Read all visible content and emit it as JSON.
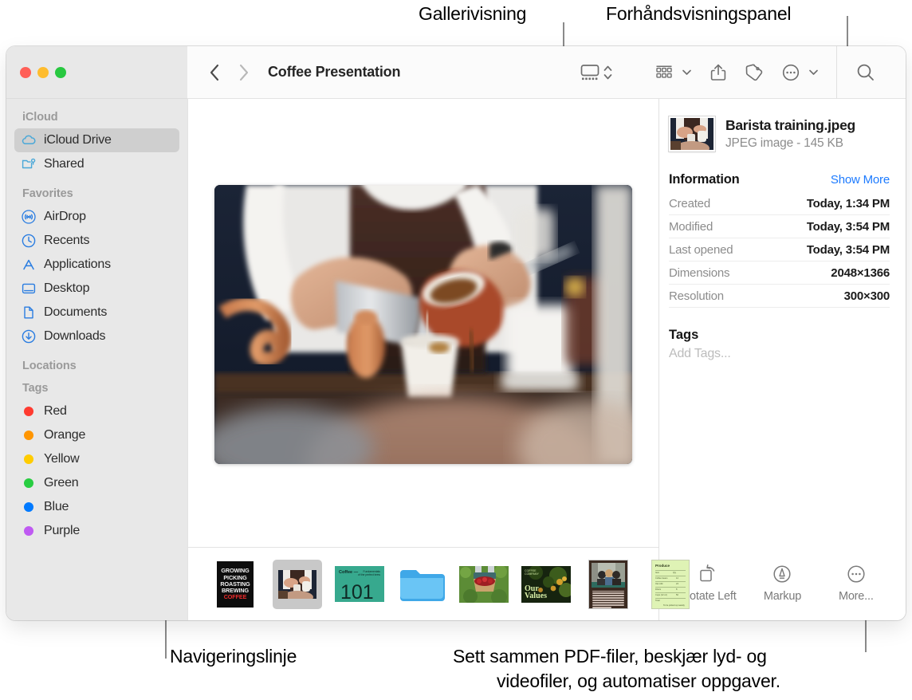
{
  "callouts": {
    "gallery_view": "Gallerivisning",
    "preview_panel": "Forhåndsvisningspanel",
    "navigation_bar": "Navigeringslinje",
    "bottom_note_line1": "Sett sammen PDF-filer, beskjær lyd- og",
    "bottom_note_line2": "videofiler, og automatiser oppgaver."
  },
  "window": {
    "title": "Coffee Presentation",
    "traffic_lights": [
      {
        "name": "close",
        "color": "#ff5f57"
      },
      {
        "name": "minimize",
        "color": "#febc2e"
      },
      {
        "name": "zoom",
        "color": "#28c840"
      }
    ],
    "toolbar": {
      "back_icon": "chevron-left-icon",
      "forward_icon": "chevron-right-icon",
      "view_gallery_icon": "gallery-view-icon",
      "view_stepper_icon": "chevron-up-down-icon",
      "group_icon": "group-by-icon",
      "group_chevron_icon": "chevron-down-icon",
      "share_icon": "share-icon",
      "tag_icon": "tag-icon",
      "more_icon": "more-circle-icon",
      "more_chevron_icon": "chevron-down-icon",
      "search_icon": "search-icon"
    }
  },
  "sidebar": {
    "sections": [
      {
        "header": "iCloud",
        "items": [
          {
            "label": "iCloud Drive",
            "icon": "icloud-icon",
            "selected": true
          },
          {
            "label": "Shared",
            "icon": "shared-folder-icon",
            "selected": false
          }
        ]
      },
      {
        "header": "Favorites",
        "items": [
          {
            "label": "AirDrop",
            "icon": "airdrop-icon",
            "selected": false
          },
          {
            "label": "Recents",
            "icon": "clock-icon",
            "selected": false
          },
          {
            "label": "Applications",
            "icon": "applications-icon",
            "selected": false
          },
          {
            "label": "Desktop",
            "icon": "desktop-icon",
            "selected": false
          },
          {
            "label": "Documents",
            "icon": "document-icon",
            "selected": false
          },
          {
            "label": "Downloads",
            "icon": "downloads-icon",
            "selected": false
          }
        ]
      },
      {
        "header": "Locations",
        "items": []
      },
      {
        "header": "Tags",
        "items": [
          {
            "label": "Red",
            "icon": "tag-dot-icon",
            "color": "#ff3b30",
            "selected": false
          },
          {
            "label": "Orange",
            "icon": "tag-dot-icon",
            "color": "#ff9500",
            "selected": false
          },
          {
            "label": "Yellow",
            "icon": "tag-dot-icon",
            "color": "#ffcc00",
            "selected": false
          },
          {
            "label": "Green",
            "icon": "tag-dot-icon",
            "color": "#28cd41",
            "selected": false
          },
          {
            "label": "Blue",
            "icon": "tag-dot-icon",
            "color": "#007aff",
            "selected": false
          },
          {
            "label": "Purple",
            "icon": "tag-dot-icon",
            "color": "#bf5af2",
            "selected": false
          }
        ]
      }
    ]
  },
  "gallery": {
    "hero_alt": "Barista pouring coffee from a carafe into a paper cup",
    "thumbnails": [
      {
        "name": "coffee-poster-thumb",
        "kind": "poster",
        "selected": false
      },
      {
        "name": "barista-photo-thumb",
        "kind": "photo",
        "selected": true
      },
      {
        "name": "coffee-101-thumb",
        "kind": "slide101",
        "selected": false
      },
      {
        "name": "folder-thumb",
        "kind": "folder",
        "selected": false
      },
      {
        "name": "berries-photo-thumb",
        "kind": "berries",
        "selected": false
      },
      {
        "name": "our-values-thumb",
        "kind": "values",
        "selected": false
      },
      {
        "name": "meeting-document-thumb",
        "kind": "doc",
        "selected": false
      },
      {
        "name": "produce-form-thumb",
        "kind": "form",
        "selected": false
      }
    ],
    "poster_lines": [
      "GROWING",
      "PICKING",
      "ROASTING",
      "BREWING"
    ],
    "poster_accent_line": "COFFEE",
    "slide101_number": "101",
    "slide101_label": "Coffee —",
    "values_title_line1": "Our",
    "values_title_line2": "Values",
    "form_title": "Produce"
  },
  "info_panel": {
    "file_name": "Barista training.jpeg",
    "file_meta": "JPEG image - 145 KB",
    "information_title": "Information",
    "show_more": "Show More",
    "rows": [
      {
        "key": "Created",
        "value": "Today, 1:34 PM"
      },
      {
        "key": "Modified",
        "value": "Today, 3:54 PM"
      },
      {
        "key": "Last opened",
        "value": "Today, 3:54 PM"
      },
      {
        "key": "Dimensions",
        "value": "2048×1366"
      },
      {
        "key": "Resolution",
        "value": "300×300"
      }
    ],
    "tags_title": "Tags",
    "tags_placeholder": "Add Tags...",
    "actions": [
      {
        "label": "Rotate Left",
        "icon": "rotate-left-icon"
      },
      {
        "label": "Markup",
        "icon": "markup-icon"
      },
      {
        "label": "More...",
        "icon": "more-circle-icon"
      }
    ]
  },
  "colors": {
    "accent_blue": "#1d7bff",
    "sidebar_bg": "#e8e8e8",
    "selected_row": "#cfcfcf"
  }
}
